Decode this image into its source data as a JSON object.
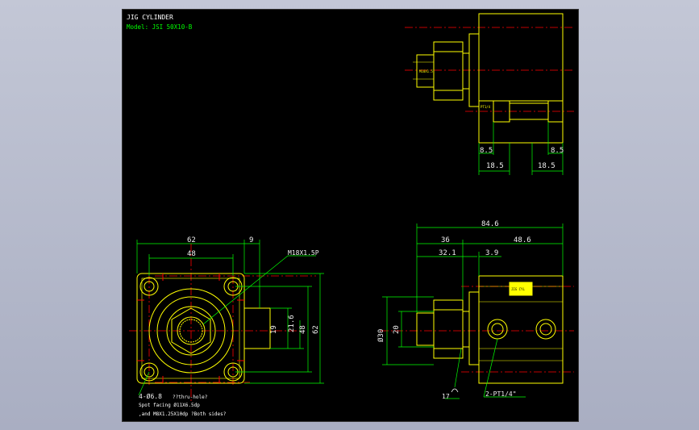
{
  "drawing": {
    "title": "JIG CYLINDER",
    "model": "Model: JSI 50X10-B"
  },
  "dims": {
    "d62": "62",
    "d9": "9",
    "d48": "48",
    "m18": "M18X1.5P",
    "d21_6": "21.6",
    "d19": "19",
    "d48v": "48",
    "d62v": "62",
    "hole1": "4-Ø6.8",
    "hole1b": "??thru-hole?",
    "hole2": "Spot facing  Ø11X6.5dp",
    "hole3": ",and M8X1.25X10dp ?Both sides?",
    "d84_6": "84.6",
    "d36": "36",
    "d48_6": "48.6",
    "d32_1": "32.1",
    "d3_9": "3.9",
    "d20": "20",
    "d30": "Ø30",
    "d17": "17",
    "port": "2-PT1/4\"",
    "d8_5a": "8.5",
    "d8_5b": "8.5",
    "d18_5a": "18.5",
    "d18_5b": "18.5"
  },
  "colors": {
    "background": "#000000",
    "outline": "#ffff00",
    "dimension": "#00ff00",
    "centerline": "#ff0000",
    "text": "#ffffff"
  }
}
